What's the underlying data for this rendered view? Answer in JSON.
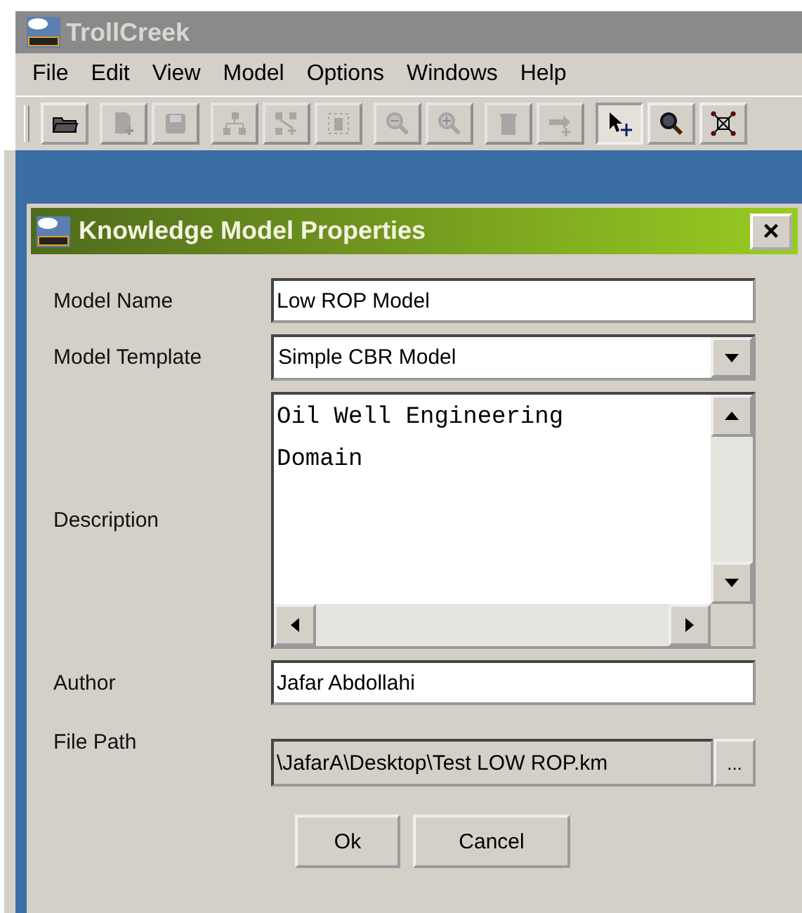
{
  "app": {
    "title": "TrollCreek"
  },
  "menu": [
    "File",
    "Edit",
    "View",
    "Model",
    "Options",
    "Windows",
    "Help"
  ],
  "toolbar": [
    [
      {
        "kind": "open",
        "disabled": false,
        "selected": false
      }
    ],
    [
      {
        "kind": "new",
        "disabled": true,
        "selected": false
      },
      {
        "kind": "save",
        "disabled": true,
        "selected": false
      }
    ],
    [
      {
        "kind": "hierarchy",
        "disabled": true,
        "selected": false
      },
      {
        "kind": "add-node",
        "disabled": true,
        "selected": false
      },
      {
        "kind": "select-delete",
        "disabled": true,
        "selected": false
      }
    ],
    [
      {
        "kind": "zoom-out",
        "disabled": true,
        "selected": false
      },
      {
        "kind": "zoom-in",
        "disabled": true,
        "selected": false
      }
    ],
    [
      {
        "kind": "trash",
        "disabled": true,
        "selected": false
      },
      {
        "kind": "arrow-add",
        "disabled": true,
        "selected": false
      }
    ],
    [
      {
        "kind": "pointer",
        "disabled": false,
        "selected": true
      },
      {
        "kind": "magnifier",
        "disabled": false,
        "selected": false
      },
      {
        "kind": "graph",
        "disabled": false,
        "selected": false
      }
    ]
  ],
  "dialog": {
    "title": "Knowledge Model Properties",
    "close": "×",
    "fields": [
      {
        "kind": "text",
        "label": "Model Name",
        "value": "Low ROP Model"
      },
      {
        "kind": "dropdown",
        "label": "Model Template",
        "value": "Simple CBR Model"
      },
      {
        "kind": "textarea",
        "label": "Description",
        "value": "Oil Well Engineering\nDomain"
      },
      {
        "kind": "text",
        "label": "Author",
        "value": "Jafar Abdollahi"
      },
      {
        "kind": "path",
        "label": "File Path",
        "value": "\\JafarA\\Desktop\\Test LOW ROP.km",
        "button": "..."
      }
    ],
    "buttons": [
      "Ok",
      "Cancel"
    ]
  }
}
